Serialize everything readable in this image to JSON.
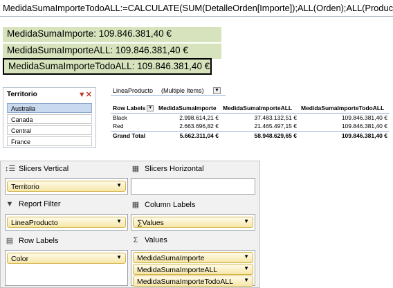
{
  "formula_bar": {
    "text": "MedidaSumaImporteTodoALL:=CALCULATE(SUM(DetalleOrden[Importe]);ALL(Orden);ALL(Producto))"
  },
  "measures": [
    {
      "text": "MedidaSumaImporte: 109.846.381,40 €"
    },
    {
      "text": "MedidaSumaImporteALL: 109.846.381,40 €"
    },
    {
      "text": "MedidaSumaImporteTodoALL: 109.846.381,40 €"
    }
  ],
  "slicer": {
    "title": "Territorio",
    "items": [
      "Australia",
      "Canada",
      "Central",
      "France"
    ],
    "selected_index": 0
  },
  "pivot": {
    "filter": {
      "label": "LineaProducto",
      "value": "(Multiple Items)"
    },
    "headers": [
      "Row Labels",
      "MedidaSumaImporte",
      "MedidaSumaImporteALL",
      "MedidaSumaImporteTodoALL"
    ],
    "rows": [
      {
        "label": "Black",
        "values": [
          "2.998.614,21 €",
          "37.483.132,51 €",
          "109.846.381,40 €"
        ]
      },
      {
        "label": "Red",
        "values": [
          "2.663.696,82 €",
          "21.465.497,15 €",
          "109.846.381,40 €"
        ]
      }
    ],
    "total": {
      "label": "Grand Total",
      "values": [
        "5.662.311,04 €",
        "58.948.629,65 €",
        "109.846.381,40 €"
      ]
    }
  },
  "field_list": {
    "slicers_vertical": {
      "title": "Slicers Vertical",
      "fields": [
        "Territorio"
      ]
    },
    "slicers_horizontal": {
      "title": "Slicers Horizontal",
      "fields": []
    },
    "report_filter": {
      "title": "Report Filter",
      "fields": [
        "LineaProducto"
      ]
    },
    "column_labels": {
      "title": "Column Labels",
      "fields": [
        "∑Values"
      ]
    },
    "row_labels": {
      "title": "Row Labels",
      "fields": [
        "Color"
      ]
    },
    "values": {
      "title": "Values",
      "fields": [
        "MedidaSumaImporte",
        "MedidaSumaImporteALL",
        "MedidaSumaImporteTodoALL"
      ]
    }
  }
}
